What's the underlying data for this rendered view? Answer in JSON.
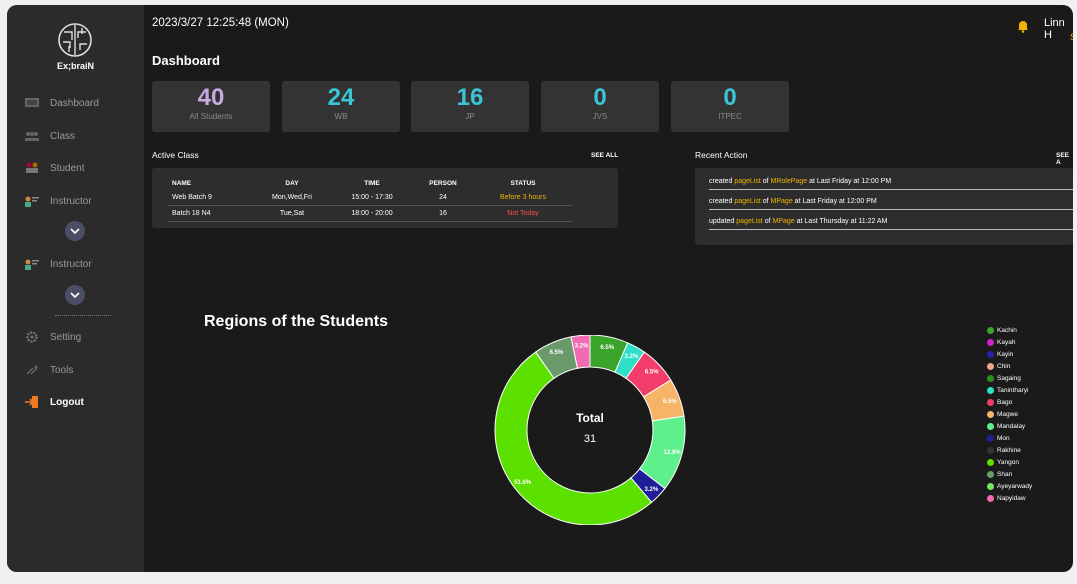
{
  "header": {
    "datetime": "2023/3/27 12:25:48 (MON)",
    "user_name": "Linn H",
    "user_sub": "S"
  },
  "sidebar": {
    "logo_text": "Ex;braiN",
    "items": [
      {
        "label": "Dashboard",
        "icon": "dashboard-icon"
      },
      {
        "label": "Class",
        "icon": "class-icon"
      },
      {
        "label": "Student",
        "icon": "student-icon"
      },
      {
        "label": "Instructor",
        "icon": "instructor-icon"
      },
      {
        "label": "Instructor",
        "icon": "instructor-icon"
      },
      {
        "label": "Setting",
        "icon": "gear-icon"
      },
      {
        "label": "Tools",
        "icon": "tools-icon"
      },
      {
        "label": "Logout",
        "icon": "logout-icon"
      }
    ]
  },
  "dashboard": {
    "title": "Dashboard",
    "stats": [
      {
        "value": "40",
        "label": "All Students",
        "color": "#c7a8e0"
      },
      {
        "value": "24",
        "label": "WB",
        "color": "#3bc4d6"
      },
      {
        "value": "16",
        "label": "JP",
        "color": "#3bc4d6"
      },
      {
        "value": "0",
        "label": "JVS",
        "color": "#3bc4d6"
      },
      {
        "value": "0",
        "label": "ITPEC",
        "color": "#3bc4d6"
      }
    ]
  },
  "active_class": {
    "title": "Active Class",
    "see_all": "SEE ALL",
    "headers": [
      "NAME",
      "DAY",
      "TIME",
      "PERSON",
      "STATUS"
    ],
    "rows": [
      {
        "name": "Web Batch 9",
        "day": "Mon,Wed,Fri",
        "time": "15:00 - 17:30",
        "person": "24",
        "status": "Before 3 hours",
        "status_color": "#f0b400"
      },
      {
        "name": "Batch 18 N4",
        "day": "Tue,Sat",
        "time": "18:00 - 20:00",
        "person": "16",
        "status": "Not Today",
        "status_color": "#ff4b4b"
      }
    ]
  },
  "recent_action": {
    "title": "Recent Action",
    "see_all": "SEE A",
    "rows": [
      {
        "verb": "created",
        "item": "pageList",
        "of": "of",
        "target": "MRolePage",
        "when": "at Last Friday at 12:00 PM"
      },
      {
        "verb": "created",
        "item": "pageList",
        "of": "of",
        "target": "MPage",
        "when": "at Last Friday at 12:00 PM"
      },
      {
        "verb": "updated",
        "item": "pageList",
        "of": "of",
        "target": "MPage",
        "when": "at Last Thursday at 11:22 AM"
      }
    ]
  },
  "chart_data": {
    "type": "pie",
    "title": "Regions of the Students",
    "center_label": "Total",
    "center_value": "31",
    "slices": [
      {
        "name": "Kachin",
        "value": 6.5,
        "color": "#3aa32a",
        "label": "6.5%"
      },
      {
        "name": "Kayah",
        "value": 0,
        "color": "#cc22cc",
        "label": ""
      },
      {
        "name": "Kayin",
        "value": 0,
        "color": "#2222aa",
        "label": ""
      },
      {
        "name": "Chin",
        "value": 0,
        "color": "#f2a58a",
        "label": ""
      },
      {
        "name": "Sagaing",
        "value": 0,
        "color": "#2e8b22",
        "label": ""
      },
      {
        "name": "Tanintharyi",
        "value": 3.2,
        "color": "#2ee0c8",
        "label": "3.2%"
      },
      {
        "name": "Bago",
        "value": 6.5,
        "color": "#f23c6a",
        "label": "6.5%"
      },
      {
        "name": "Magwe",
        "value": 6.5,
        "color": "#f5b466",
        "label": "6.5%"
      },
      {
        "name": "Mandalay",
        "value": 12.9,
        "color": "#5ef08a",
        "label": "12.9%"
      },
      {
        "name": "Mon",
        "value": 3.2,
        "color": "#1e1e99",
        "label": "3.2%"
      },
      {
        "name": "Rakhine",
        "value": 0,
        "color": "#333333",
        "label": ""
      },
      {
        "name": "Yangon",
        "value": 51.6,
        "color": "#5ce000",
        "label": "51.6%"
      },
      {
        "name": "Shan",
        "value": 6.5,
        "color": "#6a9a6a",
        "label": "6.5%"
      },
      {
        "name": "Ayeyarwady",
        "value": 0,
        "color": "#6ee85a",
        "label": ""
      },
      {
        "name": "Napyidaw",
        "value": 3.2,
        "color": "#f06ab4",
        "label": "3.2%"
      }
    ]
  }
}
